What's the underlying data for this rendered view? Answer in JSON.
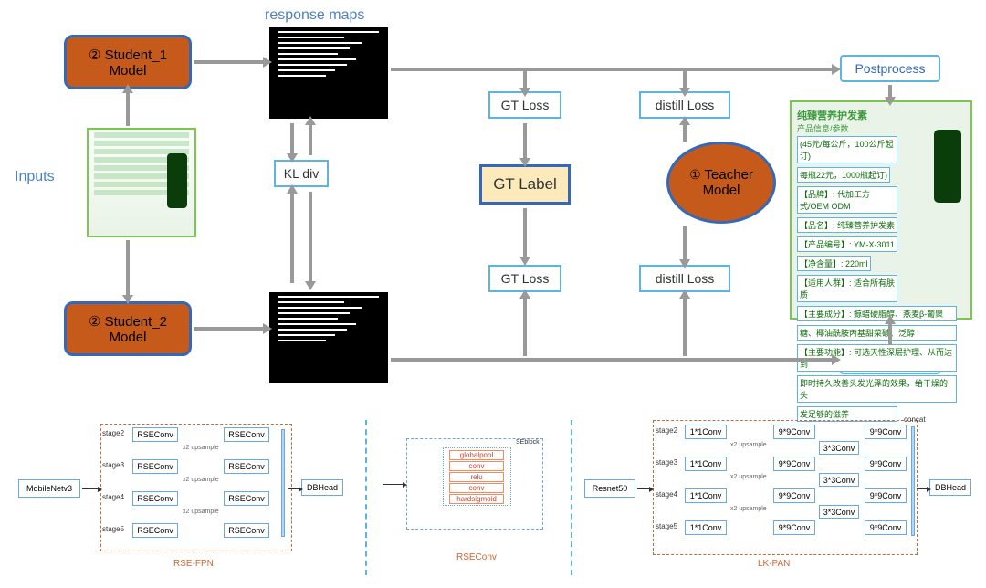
{
  "top": {
    "label_inputs": "Inputs",
    "label_rmaps": "response maps",
    "student1": {
      "circ": "②",
      "line1": "Student_1",
      "line2": "Model"
    },
    "student2": {
      "circ": "②",
      "line1": "Student_2",
      "line2": "Model"
    },
    "teacher": {
      "circ": "①",
      "line1": "Teacher",
      "line2": "Model"
    },
    "kl_div": "KL div",
    "gt_loss": "GT Loss",
    "gt_label": "GT Label",
    "distill_loss": "distill Loss",
    "postprocess": "Postprocess",
    "out_title": "纯臻营养护发素",
    "out_sub": "产品信息/参数",
    "out_lines": [
      "(45元/每公斤，100公斤起订)",
      "每瓶22元，1000瓶起订)",
      "【品牌】: 代加工方式/OEM ODM",
      "【品名】: 纯臻营养护发素",
      "【产品编号】: YM-X-3011",
      "【净含量】: 220ml",
      "【适用人群】: 适合所有肤质",
      "【主要成分】: 鲸蜡硬脂醇、燕麦β-葡聚",
      "糖、椰油酰胺丙基甜菜碱、泛醇",
      "【主要功能】: 可选天性深层护理、从而达到",
      "即时持久改善头发光泽的效果，给干燥的头",
      "发足够的滋养"
    ]
  },
  "bottom": {
    "mobilenet": "MobileNetv3",
    "rseconv": "RSEConv",
    "dbhead": "DBHead",
    "rse_fpn_cap": "RSE-FPN",
    "rseconv_cap": "RSEConv",
    "stages": [
      "stage2",
      "stage3",
      "stage4",
      "stage5"
    ],
    "x2up": "x2 upsample",
    "se_label": "SEblock",
    "se_ops": [
      "globalpool",
      "conv",
      "relu",
      "conv",
      "hardsigmoid"
    ],
    "resnet": "Resnet50",
    "conv1x1": "1*1Conv",
    "conv9x9": "9*9Conv",
    "conv3x3": "3*3Conv",
    "concat": "concat",
    "lkpan_cap": "LK-PAN"
  }
}
